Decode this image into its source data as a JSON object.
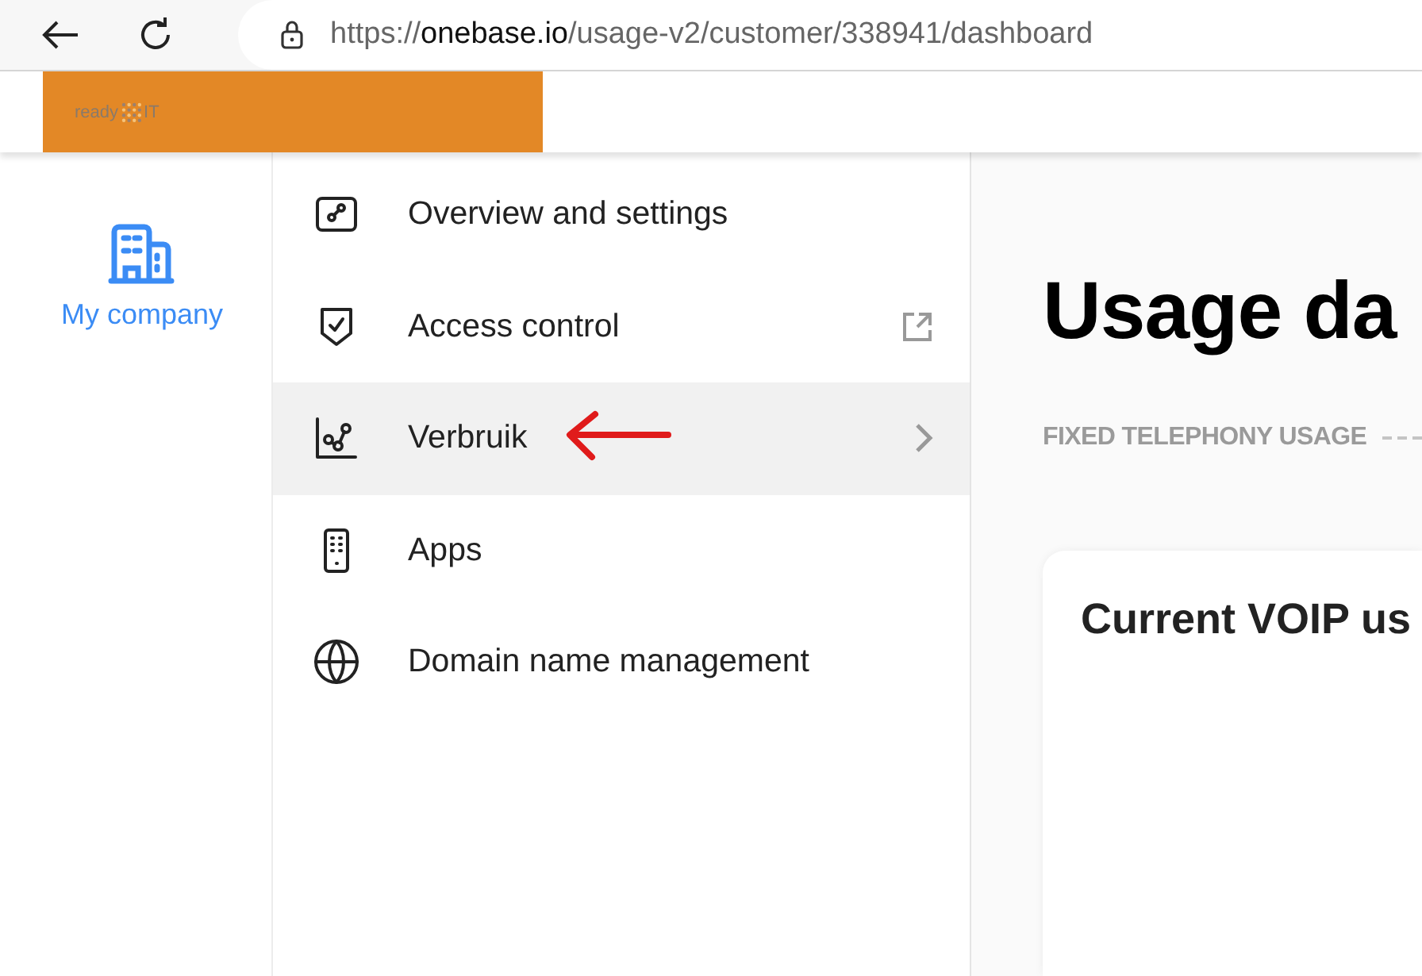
{
  "browser": {
    "url_scheme": "https://",
    "url_domain": "onebase.io",
    "url_path": "/usage-v2/customer/338941/dashboard"
  },
  "logo": {
    "left": "ready",
    "right": "IT"
  },
  "rail": {
    "label": "My company",
    "selected": true
  },
  "menu": {
    "items": [
      {
        "label": "Overview and settings",
        "selected": false,
        "external_link": false,
        "expandable": false
      },
      {
        "label": "Access control",
        "selected": false,
        "external_link": true,
        "expandable": false
      },
      {
        "label": "Verbruik",
        "selected": true,
        "external_link": false,
        "expandable": true
      },
      {
        "label": "Apps",
        "selected": false,
        "external_link": false,
        "expandable": false
      },
      {
        "label": "Domain name management",
        "selected": false,
        "external_link": false,
        "expandable": false
      }
    ]
  },
  "content": {
    "title": "Usage da",
    "section_label": "FIXED TELEPHONY USAGE",
    "card_title": "Current VOIP us"
  }
}
